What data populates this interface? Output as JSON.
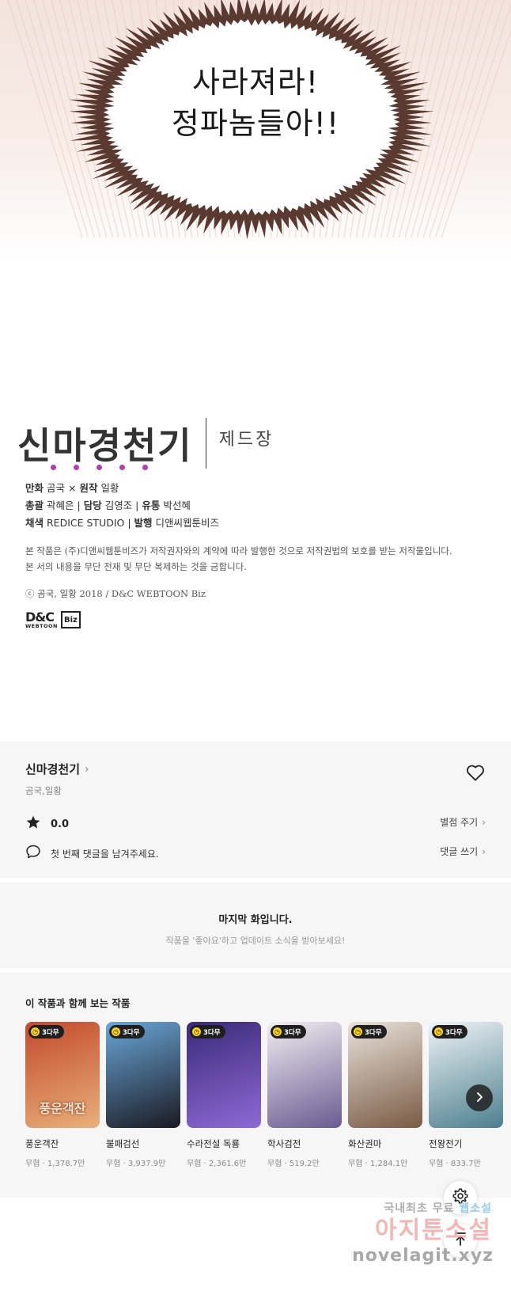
{
  "comic": {
    "line1": "사라져라!",
    "line2": "정파놈들아!!"
  },
  "credits": {
    "series_logo": "신마경천기",
    "chapter": "제드장",
    "art_label": "만화",
    "art_value": "곰국",
    "story_label": "원작",
    "story_value": "일황",
    "supervisor_label": "총괄",
    "supervisor_value": "곽혜은",
    "manager_label": "담당",
    "manager_value": "김영조",
    "dist_label": "유통",
    "dist_value": "박선혜",
    "color_label": "채색",
    "color_value": "REDICE STUDIO",
    "publisher_label": "발행",
    "publisher_value": "디앤씨웹툰비즈",
    "notice_line1": "본 작품은 (주)디앤씨웹툰비즈가 저작권자와의 계약에 따라 발행한 것으로 저작권법의 보호를 받는 저작물입니다.",
    "notice_line2": "본 서의 내용을 무단 전재 및 무단 복제하는 것을 금합니다.",
    "copyright": "ⓒ 곰국, 일황 2018 / D&C WEBTOON Biz",
    "logo_main": "D&C",
    "logo_sub": "WEBTOON",
    "logo_biz": "Biz"
  },
  "info": {
    "title": "신마경천기",
    "authors": "곰국,일황",
    "rating": "0.0",
    "rate_link": "별점 주기",
    "comment_prompt": "첫 번째 댓글을 남겨주세요.",
    "comment_link": "댓글 쓰기"
  },
  "last_episode": {
    "title": "마지막 화입니다.",
    "subtitle": "작품을 '좋아요'하고 업데이트 소식을 받아보세요!"
  },
  "recommendations": {
    "heading": "이 작품과 함께 보는 작품",
    "items": [
      {
        "name": "풍운객잔",
        "meta": "무협 · 1,378.7만",
        "badge": "3다무",
        "thumb_text": "풍운객잔",
        "color_top": "#c24a2c",
        "color_bottom": "#e9b07a"
      },
      {
        "name": "불패검선",
        "meta": "무협 · 3,937.9만",
        "badge": "3다무",
        "thumb_text": "",
        "color_top": "#6aa6d8",
        "color_bottom": "#1a1a22"
      },
      {
        "name": "수라전설 독룡",
        "meta": "무협 · 2,361.6만",
        "badge": "3다무",
        "thumb_text": "",
        "color_top": "#3b2a78",
        "color_bottom": "#8e6ad6"
      },
      {
        "name": "학사검전",
        "meta": "무협 · 519.2만",
        "badge": "3다무",
        "thumb_text": "",
        "color_top": "#f1eef0",
        "color_bottom": "#6b5a92"
      },
      {
        "name": "화산권마",
        "meta": "무협 · 1,284.1만",
        "badge": "3다무",
        "thumb_text": "",
        "color_top": "#e8e2da",
        "color_bottom": "#7a5a44"
      },
      {
        "name": "전왕전기",
        "meta": "무협 · 833.7만",
        "badge": "3다무",
        "thumb_text": "",
        "color_top": "#eef3f5",
        "color_bottom": "#4d7f8f"
      }
    ]
  },
  "watermark": {
    "line1a": "국내최초 무료",
    "line1b": "웹소설",
    "line2": "아지툰소설",
    "line3": "novelagit.xyz"
  },
  "icons": {
    "heart": "heart-icon",
    "star": "star-icon",
    "comment": "comment-icon",
    "settings": "gear-icon",
    "top": "arrow-up-icon",
    "next": "chevron-right-icon"
  }
}
